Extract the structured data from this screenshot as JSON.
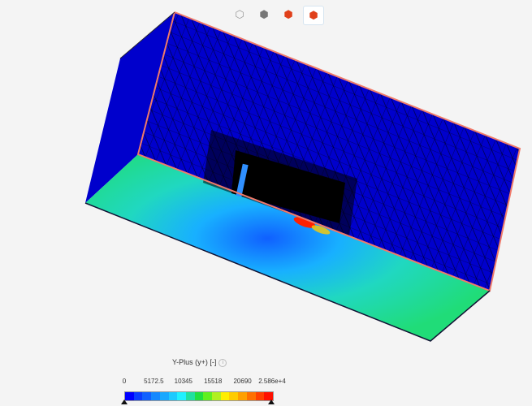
{
  "toolbar": {
    "buttons": [
      {
        "icon": "cube-outline-icon"
      },
      {
        "icon": "cube-solid-icon"
      },
      {
        "icon": "cube-mesh-red-icon"
      },
      {
        "icon": "cube-surface-red-icon",
        "active": true
      }
    ]
  },
  "legend": {
    "title": "Y-Plus (y+) [-]",
    "info_icon": "info-icon",
    "ticks": [
      "0",
      "5172.5",
      "10345",
      "15518",
      "20690",
      "2.586e+4"
    ],
    "range": [
      0,
      25860
    ],
    "colors": [
      "#0000ff",
      "#0a3cff",
      "#1060ff",
      "#1488ff",
      "#18a8ff",
      "#1ccaff",
      "#20f0ff",
      "#20e0a0",
      "#20e040",
      "#60f020",
      "#b0f020",
      "#ffee00",
      "#ffcc00",
      "#ffa000",
      "#ff7000",
      "#ff4000",
      "#ff1000"
    ]
  },
  "colors": {
    "wall": "#0000cc",
    "edge": "#f07a6a",
    "floor": "#20d878"
  }
}
